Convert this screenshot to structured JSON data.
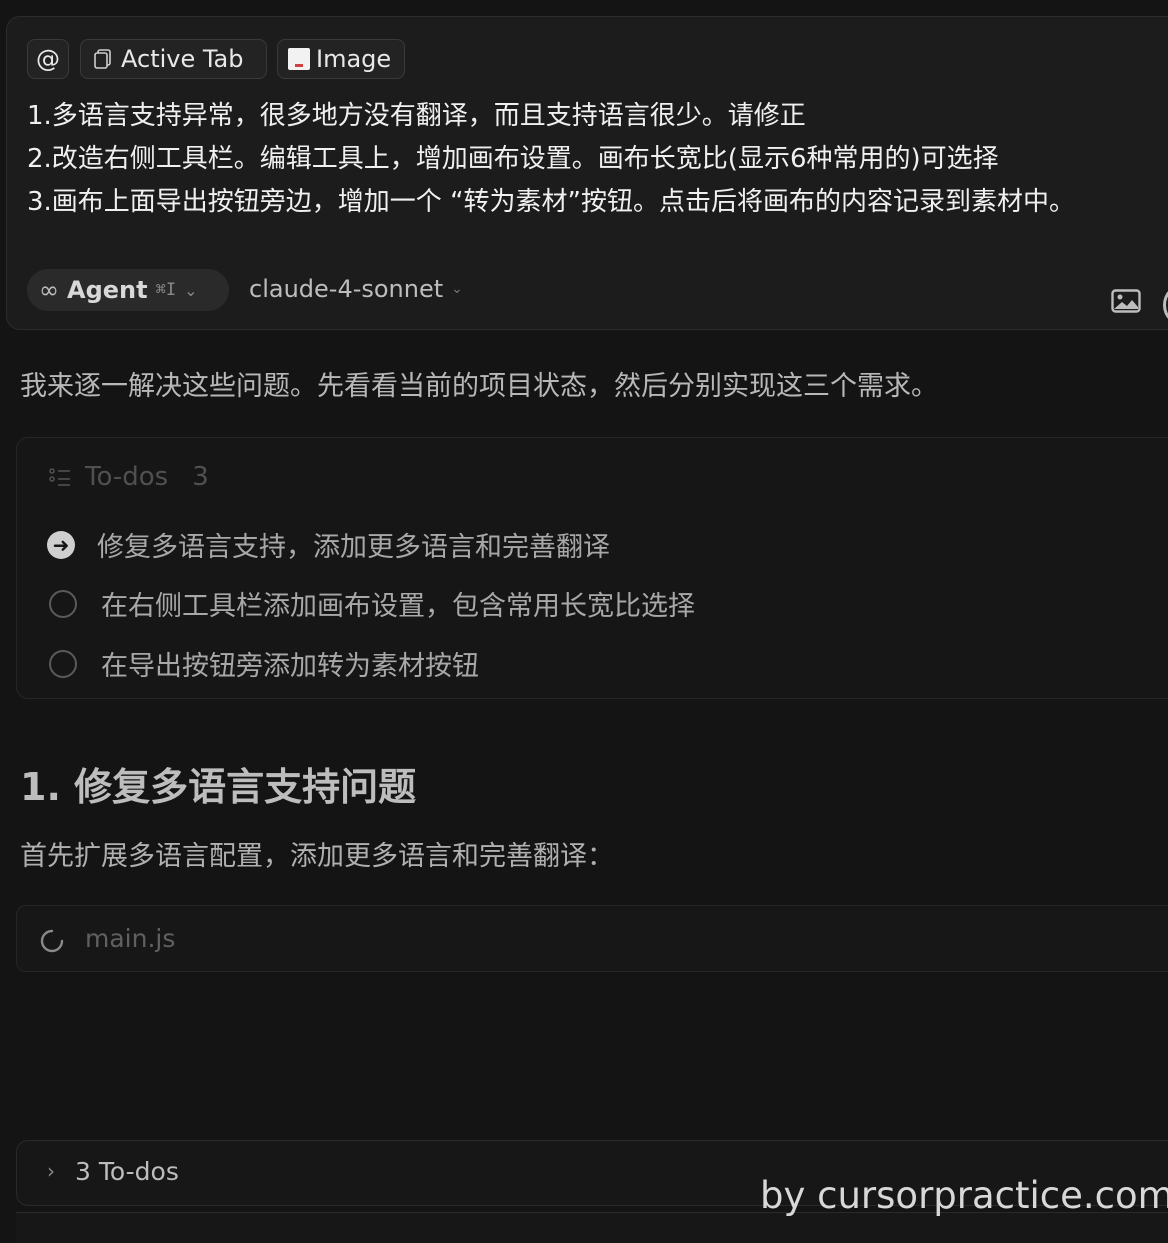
{
  "composer": {
    "at_symbol": "@",
    "context_chips": [
      {
        "label": "Active Tab",
        "icon": "file-copy-icon"
      },
      {
        "label": "Image",
        "icon": "image-thumbnail-icon"
      }
    ],
    "prompt_lines": [
      "1.多语言支持异常，很多地方没有翻译，而且支持语言很少。请修正",
      "2.改造右侧工具栏。编辑工具上，增加画布设置。画布长宽比(显示6种常用的)可选择",
      "3.画布上面导出按钮旁边，增加一个 “转为素材”按钮。点击后将画布的内容记录到素材中。"
    ],
    "mode": {
      "label": "Agent",
      "shortcut": "⌘I",
      "icon": "infinity-icon"
    },
    "model": "claude-4-sonnet"
  },
  "response": {
    "intro": "我来逐一解决这些问题。先看看当前的项目状态，然后分别实现这三个需求。",
    "todos": {
      "title": "To-dos",
      "count": "3",
      "items": [
        {
          "label": "修复多语言支持，添加更多语言和完善翻译",
          "status": "in-progress"
        },
        {
          "label": "在右侧工具栏添加画布设置，包含常用长宽比选择",
          "status": "pending"
        },
        {
          "label": "在导出按钮旁添加转为素材按钮",
          "status": "pending"
        }
      ]
    },
    "section_heading": "1. 修复多语言支持问题",
    "section_text": "首先扩展多语言配置，添加更多语言和完善翻译：",
    "file": {
      "name": "main.js",
      "status": "loading"
    }
  },
  "bottom_bar": {
    "label": "3 To-dos"
  },
  "watermark": "by cursorpractice.com"
}
